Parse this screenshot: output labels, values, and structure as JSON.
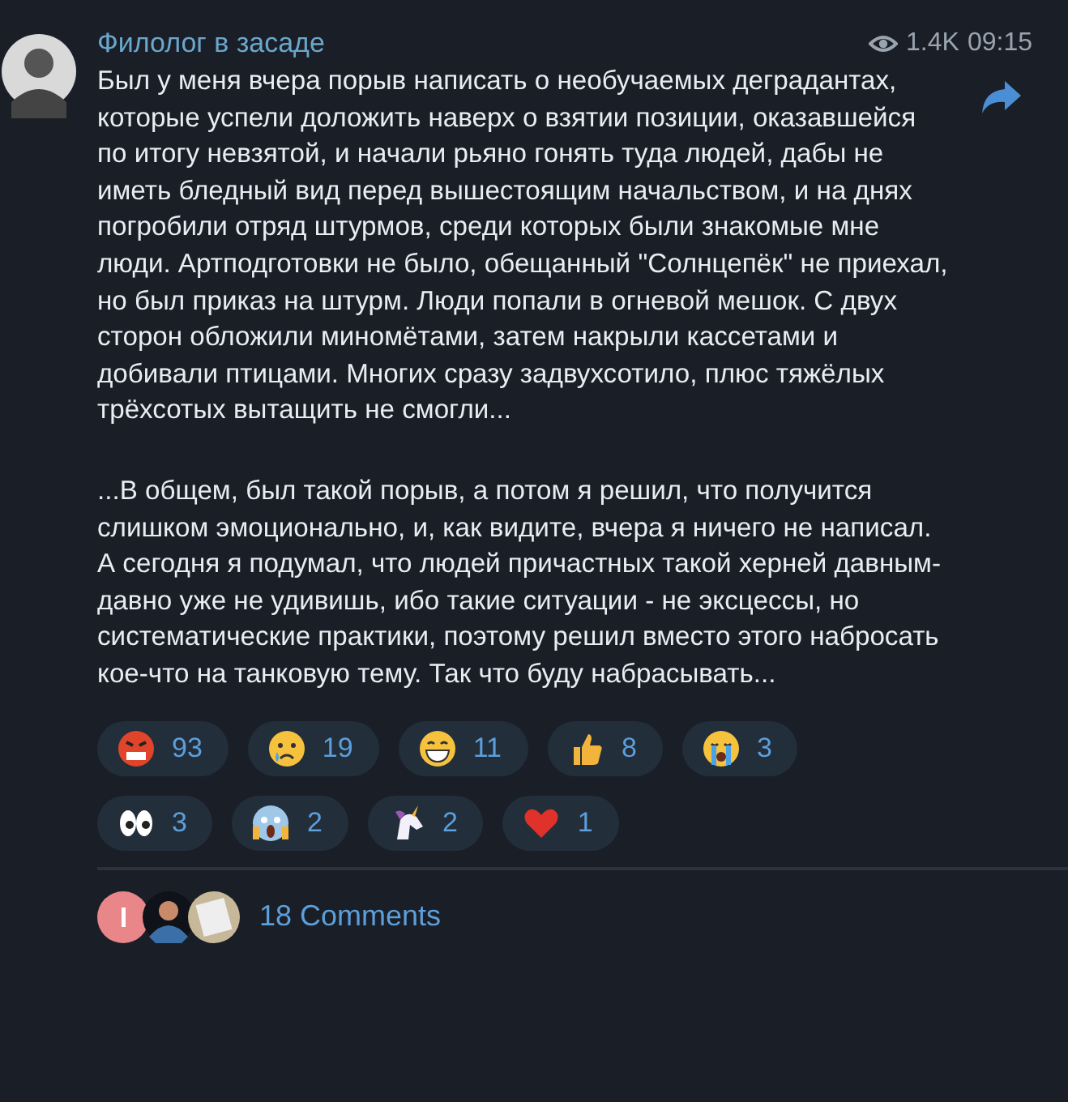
{
  "post": {
    "channel": "Филолог в засаде",
    "views": "1.4K",
    "time": "09:15",
    "paragraphs": [
      "Был у меня вчера порыв написать о необучаемых деградантах, которые успели доложить наверх о взятии позиции, оказавшейся по итогу невзятой, и начали рьяно гонять туда людей, дабы не иметь бледный вид перед вышестоящим начальством, и на днях погробили отряд штурмов, среди которых были знакомые мне люди. Артподготовки не было, обещанный \"Солнцепёк\" не приехал, но был приказ на штурм. Люди попали в огневой мешок. С двух сторон обложили миномётами, затем накрыли кассетами и добивали птицами. Многих сразу задвухсотило, плюс тяжёлых трёхсотых вытащить не смогли...",
      "...В общем, был такой порыв, а потом я решил, что получится слишком эмоционально, и, как видите, вчера я ничего не написал. А сегодня я подумал, что людей причастных такой херней давным-давно уже не удивишь, ибо такие ситуации - не эксцессы, но систематические практики, поэтому решил вместо этого набросать кое-что на танковую тему. Так что буду набрасывать..."
    ],
    "reactions": [
      {
        "kind": "angry",
        "count": "93"
      },
      {
        "kind": "sad",
        "count": "19"
      },
      {
        "kind": "grin",
        "count": "11"
      },
      {
        "kind": "thumbs",
        "count": "8"
      },
      {
        "kind": "crying",
        "count": "3"
      },
      {
        "kind": "eyes",
        "count": "3"
      },
      {
        "kind": "scream",
        "count": "2"
      },
      {
        "kind": "unicorn",
        "count": "2"
      },
      {
        "kind": "heart",
        "count": "1"
      }
    ],
    "comments": "18 Comments"
  }
}
